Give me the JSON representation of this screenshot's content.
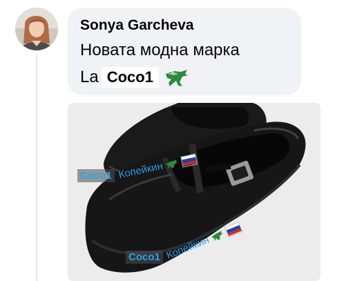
{
  "comment": {
    "author": "Sonya Garcheva",
    "text_line1": "Новата модна марка",
    "text_line2_prefix": "La",
    "text_line2_brand": "Coco1",
    "crocodile_icon": "crocodile-logo-icon"
  },
  "photo": {
    "watermark_top": {
      "brand": "Coco1",
      "text": "Копейкин",
      "icons": [
        "crocodile-logo-icon",
        "russian-flag-icon"
      ]
    },
    "watermark_bottom": {
      "brand": "Coco1",
      "text": "Копейкин",
      "icons": [
        "crocodile-logo-icon",
        "russian-flag-icon"
      ]
    }
  },
  "colors": {
    "bubble_bg": "#f0f2f5",
    "watermark_blue": "#2b9ae8",
    "crocodile_green": "#2f8a3a"
  }
}
